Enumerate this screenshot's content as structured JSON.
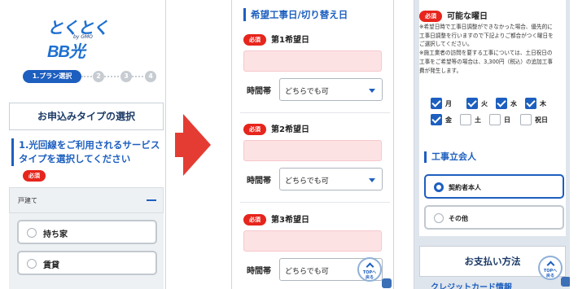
{
  "panel1": {
    "logo_text": "とくとくBB光",
    "logo_sub": "by GMO",
    "steps": {
      "current": "1.プラン選択",
      "others": [
        "2",
        "3",
        "4"
      ]
    },
    "card_title": "お申込みタイプの選択",
    "section_heading": "1.光回線をご利用されるサービスタイプを選択してください",
    "required_label": "必須",
    "accordion_label": "戸建て",
    "options": [
      "持ち家",
      "賃貸"
    ]
  },
  "panel2": {
    "heading": "希望工事日/切り替え日",
    "required_label": "必須",
    "dates": [
      {
        "label": "第1希望日",
        "time_label": "時間帯",
        "time_value": "どちらでも可"
      },
      {
        "label": "第2希望日",
        "time_label": "時間帯",
        "time_value": "どちらでも可"
      },
      {
        "label": "第3希望日",
        "time_label": "時間帯",
        "time_value": "どちらでも可"
      }
    ],
    "top_button": {
      "line1": "TOPへ",
      "line2": "戻る"
    }
  },
  "panel3": {
    "required_label": "必須",
    "possible_days_title": "可能な曜日",
    "note1": "※希望日時で工事日調整ができなかった場合、優先的に工事日調整を行いますので下記よりご都合がつく曜日をご選択してください。",
    "note2": "※施工業者の訪問を要する工事については、土日祝日の工事をご希望等の場合は、3,300円（税込）の追加工事費が発生します。",
    "days": [
      {
        "label": "月",
        "checked": true
      },
      {
        "label": "火",
        "checked": true
      },
      {
        "label": "水",
        "checked": true
      },
      {
        "label": "木",
        "checked": true
      },
      {
        "label": "金",
        "checked": true
      },
      {
        "label": "土",
        "checked": false
      },
      {
        "label": "日",
        "checked": false
      },
      {
        "label": "祝日",
        "checked": false
      }
    ],
    "attendee_heading": "工事立会人",
    "attendee_options": [
      {
        "label": "契約者本人",
        "selected": true
      },
      {
        "label": "その他",
        "selected": false
      }
    ],
    "payment_title": "お支払い方法",
    "cut_text": "クレジットカード情報",
    "top_button": {
      "line1": "TOPへ",
      "line2": "戻る"
    }
  },
  "colors": {
    "brand": "#1d5fbf",
    "required": "#e6251c",
    "arrow": "#e43c33",
    "date_input": "#fde2e4"
  }
}
